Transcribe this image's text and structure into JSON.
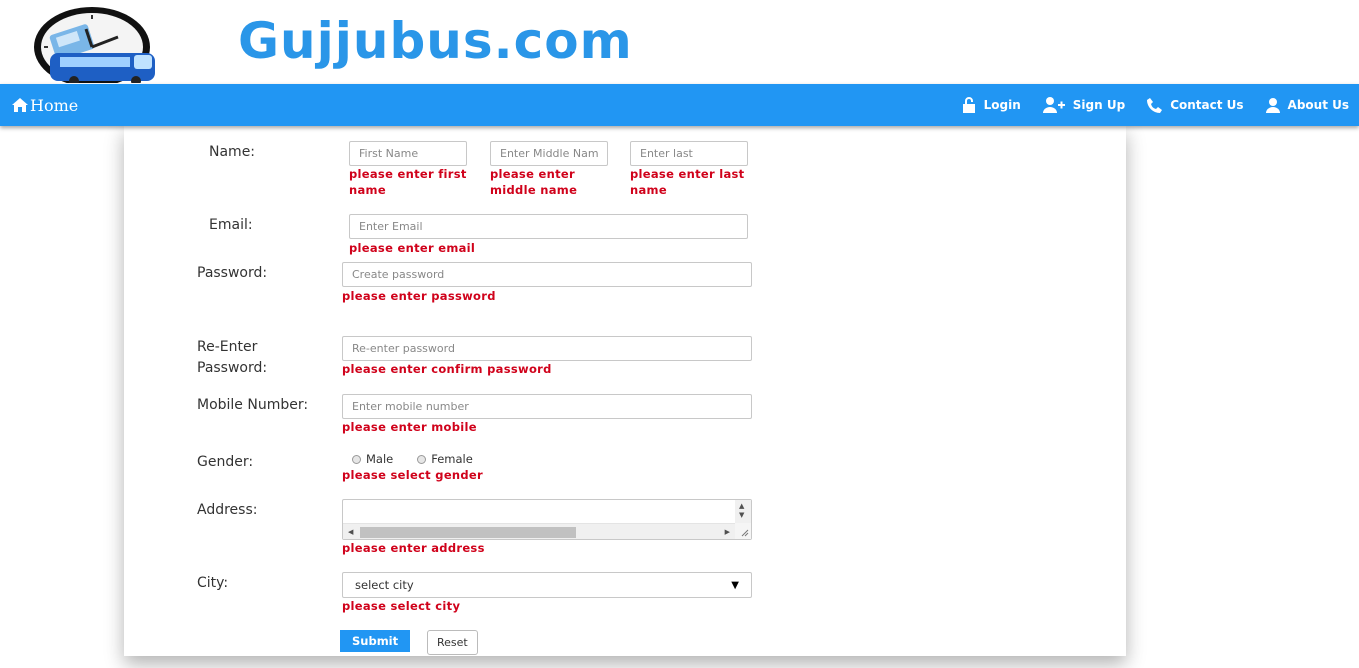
{
  "header": {
    "site_title": "Gujjubus.com"
  },
  "nav": {
    "home": "Home",
    "login": "Login",
    "signup": "Sign Up",
    "contact": "Contact Us",
    "about": "About Us"
  },
  "form": {
    "name_label": "Name:",
    "first_name_placeholder": "First Name",
    "middle_name_placeholder": "Enter Middle Name",
    "last_name_placeholder": "Enter last",
    "first_name_error": "please enter first name",
    "middle_name_error": "please enter middle name",
    "last_name_error": "please enter last name",
    "email_label": "Email:",
    "email_placeholder": "Enter Email",
    "email_error": "please enter email",
    "password_label": "Password:",
    "password_placeholder": "Create password",
    "password_error": "please enter password",
    "reenter_label_line1": "Re-Enter",
    "reenter_label_line2": "Password:",
    "reenter_placeholder": "Re-enter password",
    "reenter_error": "please enter confirm password",
    "mobile_label": "Mobile Number:",
    "mobile_placeholder": "Enter mobile number",
    "mobile_error": "please enter mobile",
    "gender_label": "Gender:",
    "gender_male": "Male",
    "gender_female": "Female",
    "gender_error": "please select gender",
    "address_label": "Address:",
    "address_error": "please enter address",
    "city_label": "City:",
    "city_selected": "select city",
    "city_error": "please select city",
    "submit_label": "Submit",
    "reset_label": "Reset"
  },
  "colors": {
    "navbar": "#2196f3",
    "brand_text": "#2a96e8",
    "error": "#d0021b"
  },
  "icons": [
    "logo-bus-clock",
    "home-icon",
    "unlock-icon",
    "add-user-icon",
    "phone-icon",
    "user-icon"
  ]
}
